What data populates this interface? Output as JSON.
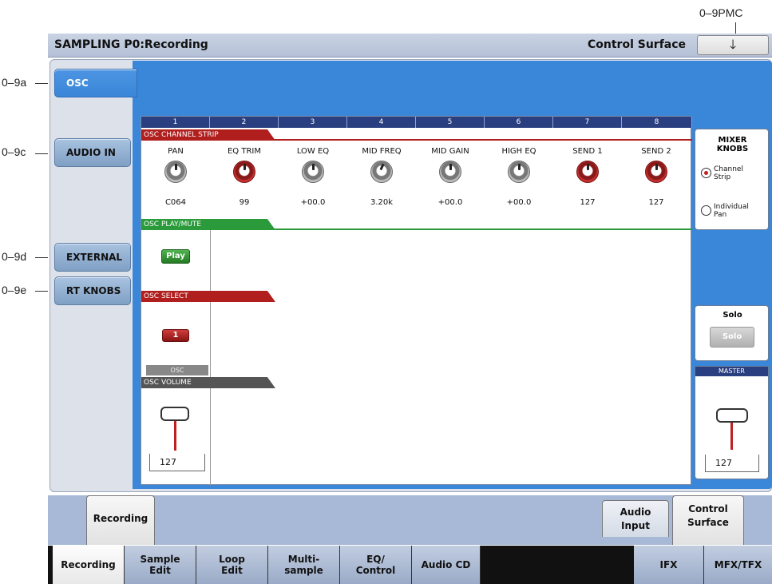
{
  "annotations": {
    "pmc": "0–9PMC",
    "a": "0–9a",
    "c": "0–9c",
    "d": "0–9d",
    "e": "0–9e"
  },
  "header": {
    "title": "SAMPLING P0:Recording",
    "page": "Control Surface",
    "menu_icon": "chevron-down-icon"
  },
  "side_tabs": [
    {
      "label": "OSC",
      "active": true
    },
    {
      "label": "AUDIO IN",
      "active": false
    },
    {
      "label": "EXTERNAL",
      "active": false
    },
    {
      "label": "RT KNOBS",
      "active": false
    }
  ],
  "channels": [
    "1",
    "2",
    "3",
    "4",
    "5",
    "6",
    "7",
    "8"
  ],
  "channel_strip": {
    "title": "OSC CHANNEL STRIP",
    "knobs": [
      {
        "label": "PAN",
        "value": "C064",
        "color": "grey"
      },
      {
        "label": "EQ TRIM",
        "value": "99",
        "color": "red"
      },
      {
        "label": "LOW EQ",
        "value": "+00.0",
        "color": "grey"
      },
      {
        "label": "MID FREQ",
        "value": "3.20k",
        "color": "grey"
      },
      {
        "label": "MID GAIN",
        "value": "+00.0",
        "color": "grey"
      },
      {
        "label": "HIGH EQ",
        "value": "+00.0",
        "color": "grey"
      },
      {
        "label": "SEND 1",
        "value": "127",
        "color": "red"
      },
      {
        "label": "SEND 2",
        "value": "127",
        "color": "red"
      }
    ]
  },
  "play_mute": {
    "title": "OSC PLAY/MUTE",
    "button": "Play"
  },
  "select": {
    "title": "OSC SELECT",
    "button": "1"
  },
  "osc_label": "OSC",
  "volume": {
    "title": "OSC VOLUME",
    "value": "127"
  },
  "mixer_knobs": {
    "title": "MIXER\nKNOBS",
    "options": [
      {
        "label": "Channel\nStrip",
        "selected": true
      },
      {
        "label": "Individual\nPan",
        "selected": false
      }
    ]
  },
  "solo": {
    "title": "Solo",
    "button": "Solo"
  },
  "master": {
    "title": "MASTER",
    "value": "127"
  },
  "bottom_tabs": [
    {
      "label": "Recording",
      "active": true
    },
    {
      "label": "Audio\nInput",
      "active": false
    },
    {
      "label": "Control\nSurface",
      "active": true
    }
  ],
  "nav": [
    {
      "label": "Recording",
      "active": true
    },
    {
      "label": "Sample\nEdit",
      "active": false
    },
    {
      "label": "Loop\nEdit",
      "active": false
    },
    {
      "label": "Multi-\nsample",
      "active": false
    },
    {
      "label": "EQ/\nControl",
      "active": false
    },
    {
      "label": "Audio CD",
      "active": false
    },
    {
      "label": "IFX",
      "active": false
    },
    {
      "label": "MFX/TFX",
      "active": false
    }
  ],
  "colors": {
    "accent_blue": "#3a86d8",
    "strip_red": "#b01e1e",
    "playmute_green": "#2a9a3a",
    "volume_grey": "#555555",
    "channel_header": "#2a3f80"
  }
}
